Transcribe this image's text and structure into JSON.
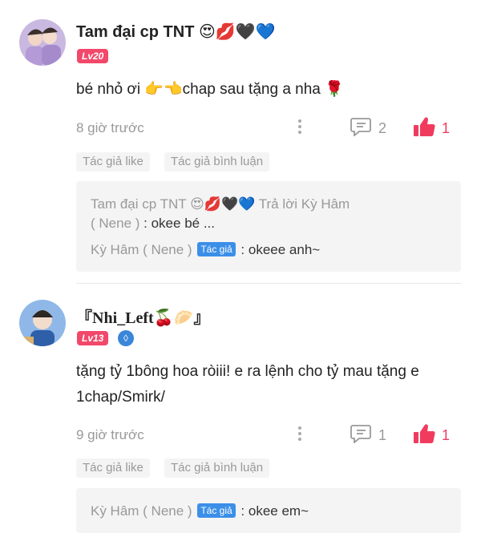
{
  "comments": [
    {
      "name": "Tam đại cp TNT 😍💋🖤💙",
      "level": "Lv20",
      "text": "bé nhỏ ơi 👉👈chap sau tặng a nha 🌹",
      "time": "8 giờ trước",
      "reply_count": "2",
      "like_count": "1",
      "tags": [
        "Tác giả like",
        "Tác giả bình luận"
      ],
      "replies": [
        {
          "author": "Tam đại cp TNT 😍💋🖤💙",
          "action": "Trả lời",
          "target": "Kỳ Hâm",
          "target2": "( Nene )",
          "text": ": okee bé ..."
        },
        {
          "author": "Kỳ Hâm ( Nene )",
          "badge": "Tác giả",
          "text": ": okeee anh~"
        }
      ]
    },
    {
      "name": "『Nhi_Left🍒🥟』",
      "level": "Lv13",
      "text_line1": "tặng tỷ 1bông hoa ròiii! e ra lệnh cho tỷ mau tặng e",
      "text_line2": "1chap/Smirk/",
      "time": "9 giờ trước",
      "reply_count": "1",
      "like_count": "1",
      "tags": [
        "Tác giả like",
        "Tác giả bình luận"
      ],
      "replies": [
        {
          "author": "Kỳ Hâm ( Nene )",
          "badge": "Tác giả",
          "text": ": okee em~"
        }
      ]
    }
  ],
  "colors": {
    "accent": "#f03b5f",
    "badge_blue": "#3b8fe8",
    "level_pink": "#f2486a"
  }
}
